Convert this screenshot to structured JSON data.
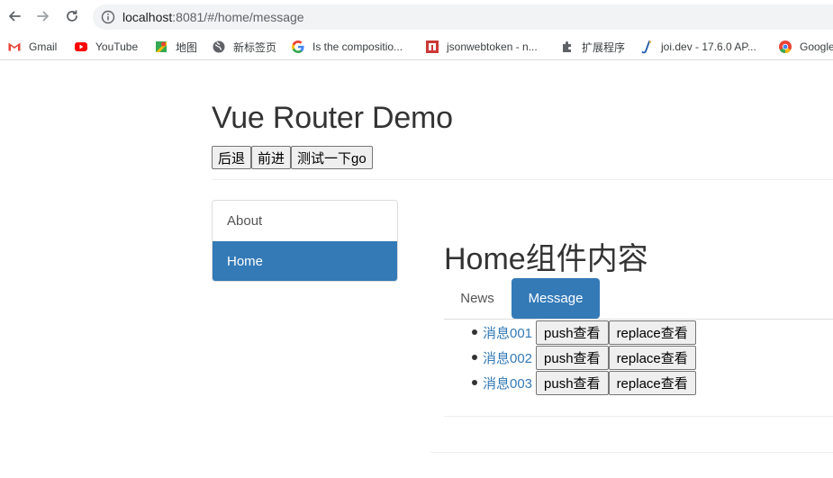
{
  "browser": {
    "url_host": "localhost",
    "url_rest": ":8081/#/home/message",
    "bookmarks": [
      {
        "label": "Gmail",
        "icon": "gmail-icon"
      },
      {
        "label": "YouTube",
        "icon": "youtube-icon"
      },
      {
        "label": "地图",
        "icon": "maps-icon"
      },
      {
        "label": "新标签页",
        "icon": "globe-icon"
      },
      {
        "label": "Is the compositio...",
        "icon": "google-icon"
      },
      {
        "label": "jsonwebtoken - n...",
        "icon": "npm-icon"
      },
      {
        "label": "扩展程序",
        "icon": "puzzle-icon"
      },
      {
        "label": "joi.dev - 17.6.0 AP...",
        "icon": "joi-icon"
      },
      {
        "label": "Google",
        "icon": "chrome-icon"
      }
    ]
  },
  "page": {
    "title": "Vue Router Demo",
    "buttons": {
      "back": "后退",
      "forward": "前进",
      "go": "测试一下go"
    },
    "sidebar": [
      {
        "label": "About",
        "active": false
      },
      {
        "label": "Home",
        "active": true
      }
    ],
    "home_title": "Home组件内容",
    "tabs": [
      {
        "label": "News",
        "active": false
      },
      {
        "label": "Message",
        "active": true
      }
    ],
    "messages": [
      {
        "title": "消息001",
        "push": "push查看",
        "replace": "replace查看"
      },
      {
        "title": "消息002",
        "push": "push查看",
        "replace": "replace查看"
      },
      {
        "title": "消息003",
        "push": "push查看",
        "replace": "replace查看"
      }
    ]
  },
  "colors": {
    "accent": "#337ab7",
    "text": "#333333",
    "link": "#337ab7"
  }
}
